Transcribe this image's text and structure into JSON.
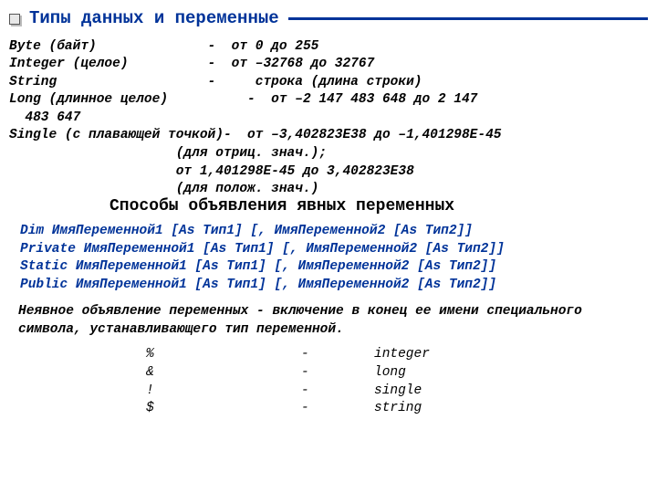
{
  "title": "Типы данных и переменные",
  "types_text": "Byte (байт)              -  от 0 до 255\nInteger (целое)          -  от –32768 до 32767\nString                   -     строка (длина строки)\nLong (длинное целое)          -  от –2 147 483 648 до 2 147\n  483 647\nSingle (с плавающей точкой)-  от –3,402823E38 до –1,401298E-45\n                     (для отриц. знач.);\n                     от 1,401298E-45 до 3,402823E38\n                     (для полож. знач.)",
  "declare_title": "Способы объявления явных переменных",
  "decl_text": "Dim ИмяПеременной1 [As Тип1] [, ИмяПеременной2 [As Тип2]]\nPrivate ИмяПеременной1 [As Тип1] [, ИмяПеременной2 [As Тип2]]\nStatic ИмяПеременной1 [As Тип1] [, ИмяПеременной2 [As Тип2]]\nPublic ИмяПеременной1 [As Тип1] [, ИмяПеременной2 [As Тип2]]",
  "implicit_text": "Неявное объявление переменных - включение в конец ее имени специального символа, устанавливающего тип переменной.",
  "symbols": {
    "rows": [
      {
        "sym": "%",
        "dash": "-",
        "type": "integer"
      },
      {
        "sym": "&",
        "dash": "-",
        "type": "long"
      },
      {
        "sym": "!",
        "dash": "-",
        "type": "single"
      },
      {
        "sym": "$",
        "dash": "-",
        "type": "string"
      }
    ]
  }
}
